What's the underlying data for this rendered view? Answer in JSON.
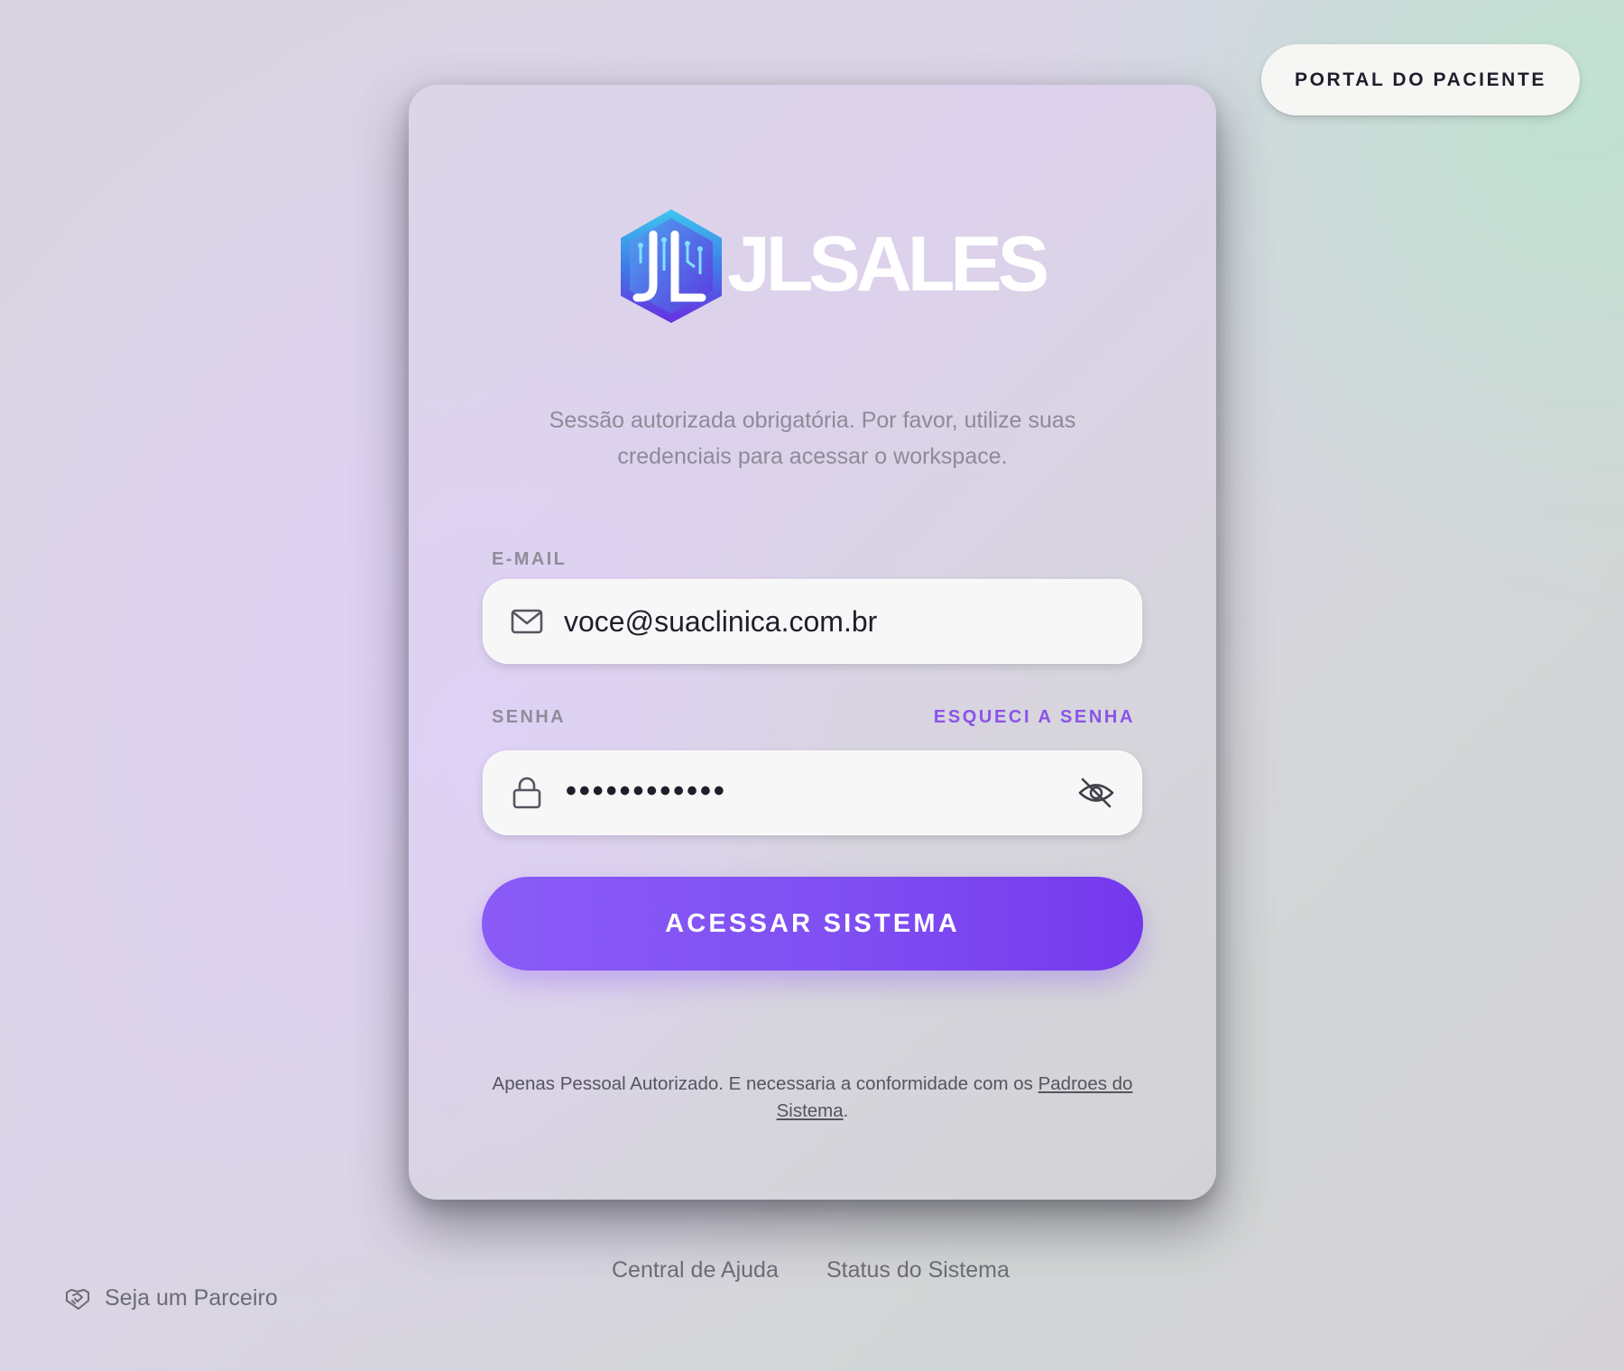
{
  "header": {
    "portal_button_label": "PORTAL DO PACIENTE"
  },
  "brand": {
    "logo_text": "JLSALES",
    "logo_icon": "jl-hexagon-circuit-logo"
  },
  "login": {
    "subtitle": "Sessão autorizada obrigatória. Por favor, utilize suas credenciais para acessar o workspace.",
    "email_label": "E-MAIL",
    "email_value": "voce@suaclinica.com.br",
    "password_label": "SENHA",
    "forgot_password_label": "ESQUECI A SENHA",
    "password_masked": "••••••••••••",
    "submit_label": "ACESSAR SISTEMA",
    "footnote_text": "Apenas Pessoal Autorizado. E necessaria a conformidade com os ",
    "footnote_link": "Padroes do Sistema",
    "footnote_end": "."
  },
  "footer": {
    "help_link": "Central de Ajuda",
    "status_link": "Status do Sistema",
    "partner_link": "Seja um Parceiro"
  },
  "colors": {
    "accent": "#7f4ff2",
    "forgot_link": "#8b53e8",
    "text_dark": "#1e1f2b"
  }
}
